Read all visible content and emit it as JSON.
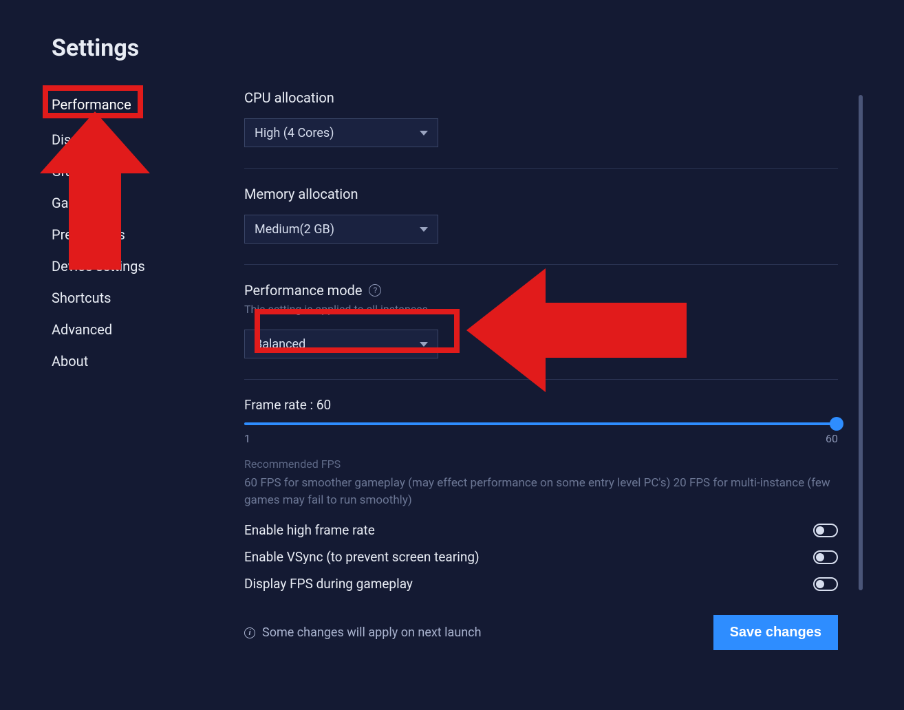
{
  "title": "Settings",
  "sidebar": {
    "items": [
      {
        "label": "Performance",
        "active": true
      },
      {
        "label": "Display"
      },
      {
        "label": "Graphics"
      },
      {
        "label": "Gamepad"
      },
      {
        "label": "Preferences"
      },
      {
        "label": "Device settings"
      },
      {
        "label": "Shortcuts"
      },
      {
        "label": "Advanced"
      },
      {
        "label": "About"
      }
    ]
  },
  "cpu": {
    "label": "CPU allocation",
    "value": "High (4 Cores)"
  },
  "memory": {
    "label": "Memory allocation",
    "value": "Medium(2 GB)"
  },
  "perfmode": {
    "label": "Performance mode",
    "sub": "This setting is applied to all instances",
    "value": "Balanced"
  },
  "framerate": {
    "label": "Frame rate : 60",
    "min": "1",
    "max": "60",
    "rec_head": "Recommended FPS",
    "rec_body": "60 FPS for smoother gameplay (may effect performance on some entry level PC's) 20 FPS for multi-instance (few games may fail to run smoothly)"
  },
  "toggles": {
    "high_fr": "Enable high frame rate",
    "vsync": "Enable VSync (to prevent screen tearing)",
    "show_fps": "Display FPS during gameplay"
  },
  "footer": {
    "note": "Some changes will apply on next launch",
    "save": "Save changes"
  }
}
